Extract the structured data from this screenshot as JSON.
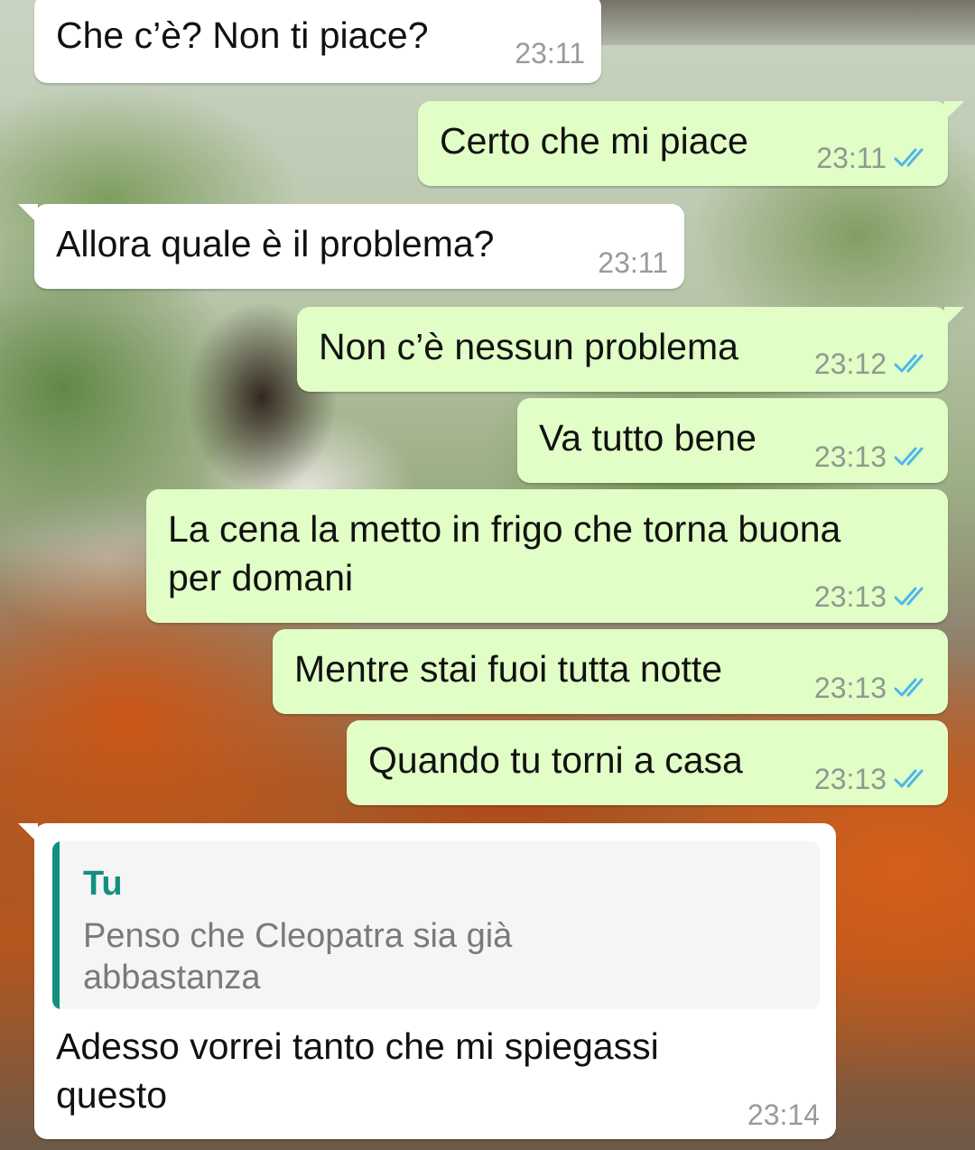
{
  "chat": {
    "messages": [
      {
        "direction": "in",
        "text": "Che c’è? Non ti piace?",
        "time": "23:11"
      },
      {
        "direction": "out",
        "text": "Certo che mi piace",
        "time": "23:11",
        "status": "read"
      },
      {
        "direction": "in",
        "text": "Allora quale è il problema?",
        "time": "23:11"
      },
      {
        "direction": "out",
        "text": "Non c’è nessun problema",
        "time": "23:12",
        "status": "read"
      },
      {
        "direction": "out",
        "text": "Va tutto bene",
        "time": "23:13",
        "status": "read"
      },
      {
        "direction": "out",
        "text": "La cena la metto in frigo che torna buona\nper domani",
        "time": "23:13",
        "status": "read"
      },
      {
        "direction": "out",
        "text": "Mentre stai fuoi tutta notte",
        "time": "23:13",
        "status": "read"
      },
      {
        "direction": "out",
        "text": "Quando tu torni a casa",
        "time": "23:13",
        "status": "read"
      },
      {
        "direction": "in",
        "quote": {
          "author": "Tu",
          "text": "Penso che Cleopatra sia già abbastanza"
        },
        "text": "Adesso vorrei tanto che mi spiegassi\nquesto",
        "time": "23:14"
      }
    ]
  },
  "theme": {
    "incoming_bubble": "#ffffff",
    "outgoing_bubble": "#e1fec6",
    "read_tick": "#4fb6ec",
    "quote_accent": "#12907e"
  },
  "icons": {
    "read_receipt": "double-check-icon"
  }
}
